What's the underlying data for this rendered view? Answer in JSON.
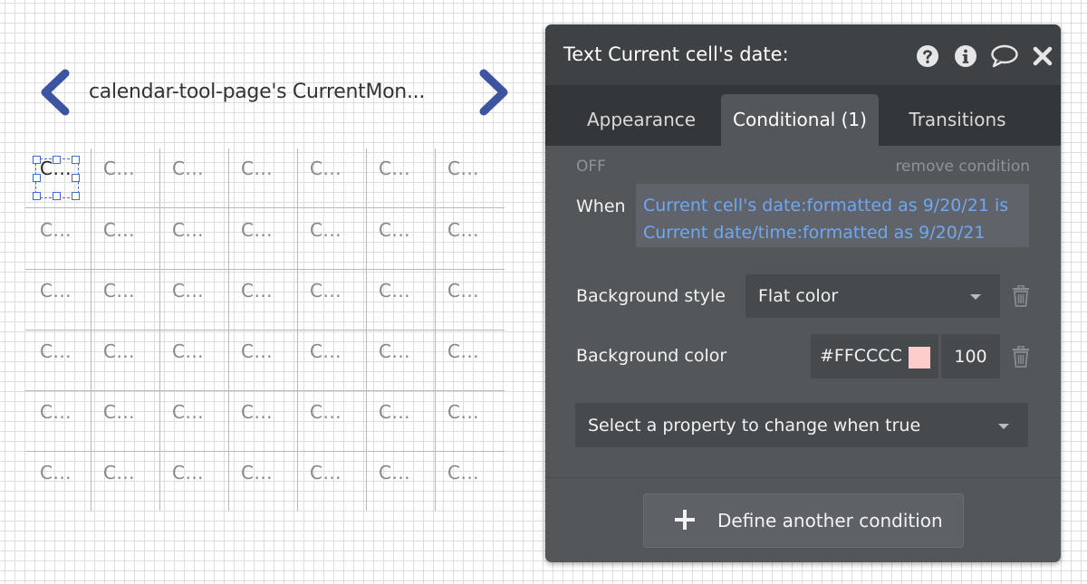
{
  "canvas": {
    "title": "calendar-tool-page's CurrentMon...",
    "cell_text": "C...",
    "rows": 6,
    "cols": 7,
    "accent_color": "#3d55a0",
    "selection_color": "#3c6fd0"
  },
  "panel": {
    "title": "Text Current cell's date:",
    "header_icons": [
      "help-icon",
      "info-icon",
      "comment-icon",
      "close-icon"
    ],
    "tabs": [
      {
        "label": "Appearance",
        "active": false
      },
      {
        "label": "Conditional (1)",
        "active": true
      },
      {
        "label": "Transitions",
        "active": false
      }
    ],
    "condition": {
      "state": "OFF",
      "remove_label": "remove condition",
      "when_label": "When",
      "expression_line1": "Current cell's date:formatted as 9/20/21 is",
      "expression_line2": "Current date/time:formatted as 9/20/21"
    },
    "background_style": {
      "label": "Background style",
      "value": "Flat color"
    },
    "background_color": {
      "label": "Background color",
      "hex": "#FFCCCC",
      "swatch_color": "#ffcccc",
      "opacity": "100"
    },
    "property_select": {
      "placeholder": "Select a property to change when true"
    },
    "define_button": {
      "label": "Define another condition"
    }
  }
}
